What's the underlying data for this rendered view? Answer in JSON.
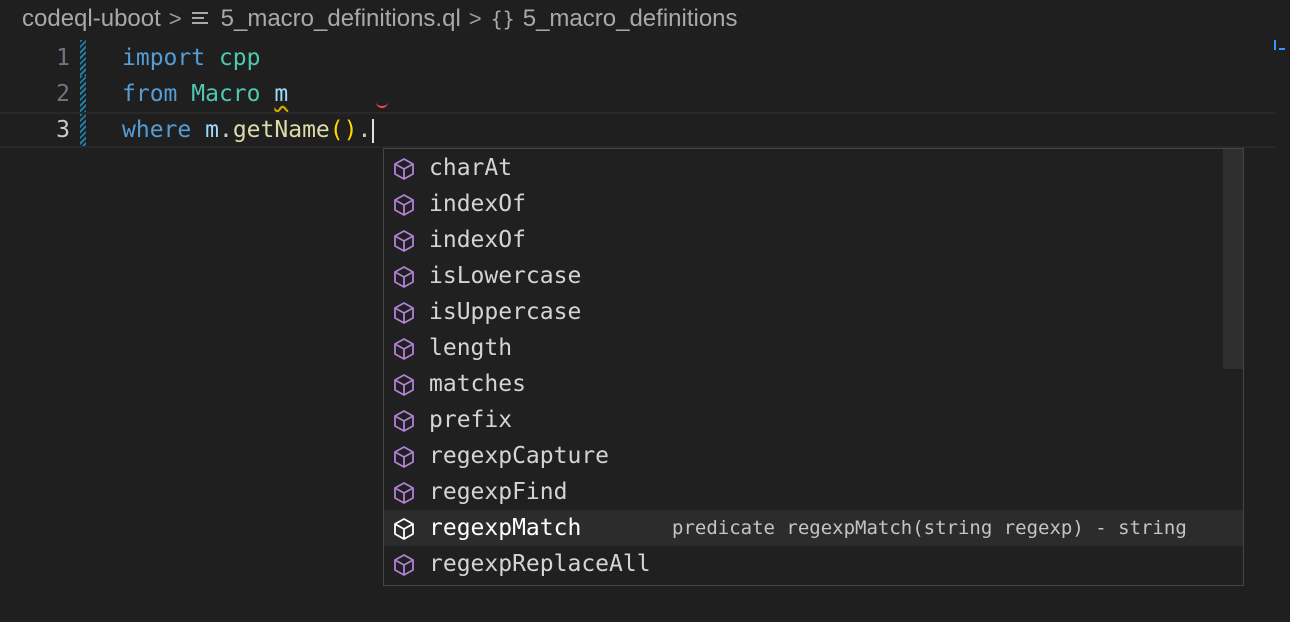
{
  "breadcrumb": {
    "workspace": "codeql-uboot",
    "file": "5_macro_definitions.ql",
    "symbol": "5_macro_definitions",
    "separator": ">"
  },
  "editor": {
    "lines": [
      {
        "number": "1",
        "tokens": [
          "import",
          " ",
          "cpp"
        ]
      },
      {
        "number": "2",
        "tokens": [
          "from",
          " ",
          "Macro",
          " ",
          "m"
        ]
      },
      {
        "number": "3",
        "tokens": [
          "where",
          " ",
          "m",
          ".",
          "getName",
          "(",
          ")",
          "."
        ]
      }
    ]
  },
  "suggest": {
    "items": [
      {
        "label": "charAt"
      },
      {
        "label": "indexOf"
      },
      {
        "label": "indexOf"
      },
      {
        "label": "isLowercase"
      },
      {
        "label": "isUppercase"
      },
      {
        "label": "length"
      },
      {
        "label": "matches"
      },
      {
        "label": "prefix"
      },
      {
        "label": "regexpCapture"
      },
      {
        "label": "regexpFind"
      },
      {
        "label": "regexpMatch",
        "detail": "predicate regexpMatch(string regexp) - string",
        "selected": true
      },
      {
        "label": "regexpReplaceAll"
      }
    ],
    "icon": "method-cube-icon",
    "icon_color": "#b180d7",
    "selected_icon_color": "#ffffff"
  },
  "colors": {
    "keyword": "#569cd6",
    "type": "#4ec9b0",
    "variable": "#9cdcfe",
    "function": "#dcdcaa",
    "bracket": "#ffd700"
  }
}
